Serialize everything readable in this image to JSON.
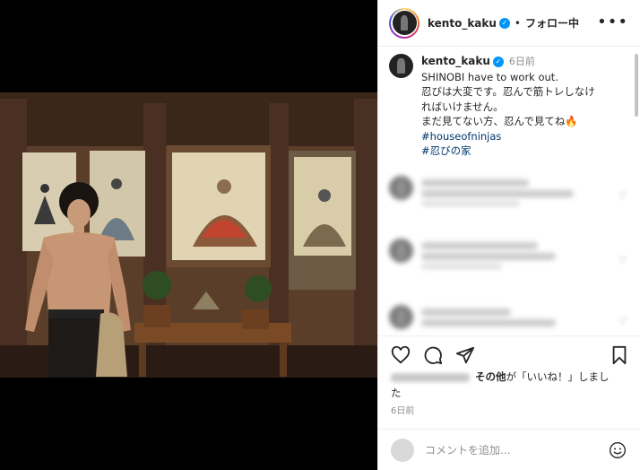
{
  "header": {
    "username": "kento_kaku",
    "separator": "•",
    "follow_label": "フォロー中",
    "more_label": "•••"
  },
  "caption": {
    "username": "kento_kaku",
    "time": "6日前",
    "lines": [
      "SHINOBI have to work out.",
      "忍びは大変です。忍んで筋トレしなけ",
      "ればいけません。",
      "まだ見てない方、忍んで見てね🔥"
    ],
    "hashtags": [
      "#houseofninjas",
      "#忍びの家"
    ]
  },
  "likes": {
    "text_bold": "その他",
    "text_rest": "が「いいね！」しまし",
    "text_wrap": "た"
  },
  "posted_ago": "6日前",
  "comment_input": {
    "placeholder": "コメントを追加..."
  },
  "icons": {
    "verified": "verified-badge-icon",
    "like": "heart-icon",
    "comment": "comment-icon",
    "share": "send-icon",
    "save": "bookmark-icon",
    "emoji": "emoji-icon",
    "more": "more-icon"
  },
  "colors": {
    "verified": "#0095f6",
    "hashtag": "#00376b",
    "muted": "#8e8e8e"
  }
}
